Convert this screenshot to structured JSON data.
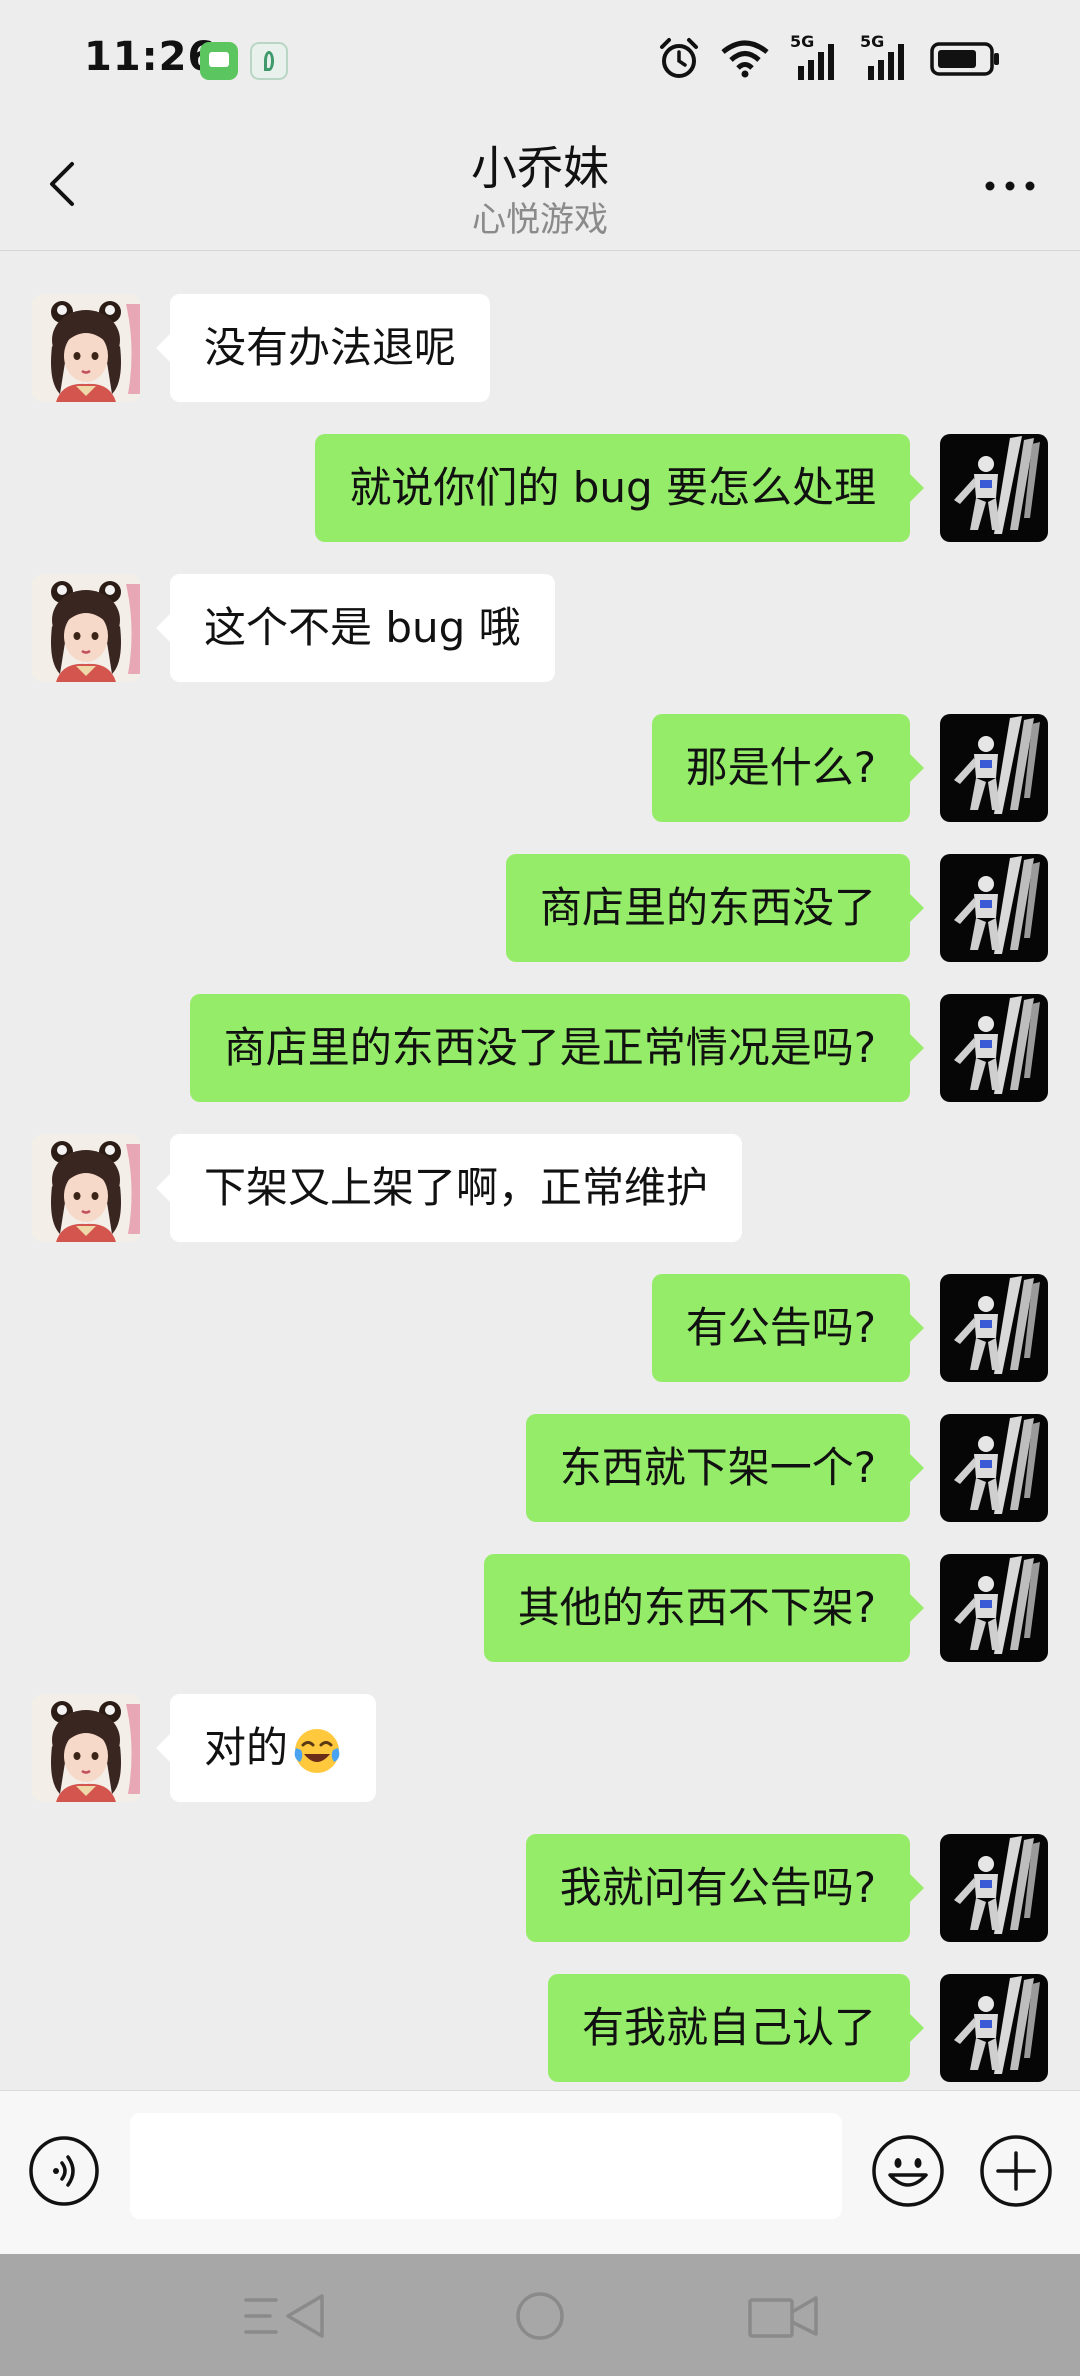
{
  "status_bar": {
    "time": "11:26",
    "network_label_1": "5G",
    "network_label_2": "5G",
    "icons": [
      "messages-app-icon",
      "leaf-app-icon",
      "alarm-icon",
      "wifi-icon",
      "signal-5g-icon",
      "signal-5g-icon",
      "battery-icon"
    ]
  },
  "header": {
    "title": "小乔妹",
    "subtitle": "心悦游戏",
    "back_icon": "chevron-left-icon",
    "more_icon": "more-dots-icon"
  },
  "messages": [
    {
      "side": "left",
      "text": "没有办法退呢"
    },
    {
      "side": "right",
      "text": "就说你们的 bug 要怎么处理"
    },
    {
      "side": "left",
      "text": "这个不是 bug 哦"
    },
    {
      "side": "right",
      "text": "那是什么?"
    },
    {
      "side": "right",
      "text": "商店里的东西没了"
    },
    {
      "side": "right",
      "text": "商店里的东西没了是正常情况是吗?"
    },
    {
      "side": "left",
      "text": "下架又上架了啊，正常维护"
    },
    {
      "side": "right",
      "text": "有公告吗?"
    },
    {
      "side": "right",
      "text": "东西就下架一个?"
    },
    {
      "side": "right",
      "text": "其他的东西不下架?"
    },
    {
      "side": "left",
      "text": "对的",
      "emoji": "laughing-crying-emoji"
    },
    {
      "side": "right",
      "text": "我就问有公告吗?"
    },
    {
      "side": "right",
      "text": "有我就自己认了"
    }
  ],
  "input_bar": {
    "text_value": "",
    "voice_icon": "voice-icon",
    "emoji_icon": "smiley-icon",
    "plus_icon": "plus-circle-icon"
  },
  "nav_bar": {
    "icons": [
      "menu-back-icon",
      "home-circle-icon",
      "recents-icon"
    ]
  },
  "colors": {
    "background": "#ededed",
    "sent_bubble": "#95ec69",
    "received_bubble": "#ffffff",
    "nav_bar": "#a7a7a7"
  }
}
